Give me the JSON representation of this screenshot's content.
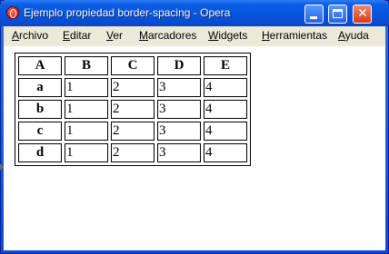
{
  "window": {
    "title": "Ejemplo propiedad border-spacing - Opera",
    "app_icon": "opera-icon",
    "controls": [
      "minimize",
      "maximize",
      "close"
    ]
  },
  "menubar": {
    "items": [
      {
        "label_first": "A",
        "label_rest": "rchivo"
      },
      {
        "label_first": "E",
        "label_rest": "ditar"
      },
      {
        "label_first": "V",
        "label_rest": "er"
      },
      {
        "label_first": "M",
        "label_rest": "arcadores"
      },
      {
        "label_first": "W",
        "label_rest": "idgets"
      },
      {
        "label_first": "H",
        "label_rest": "erramientas"
      },
      {
        "label_first": "A",
        "label_rest": "yuda"
      }
    ]
  },
  "table": {
    "headers": [
      "A",
      "B",
      "C",
      "D",
      "E"
    ],
    "rows": [
      {
        "label": "a",
        "cells": [
          "1",
          "2",
          "3",
          "4"
        ]
      },
      {
        "label": "b",
        "cells": [
          "1",
          "2",
          "3",
          "4"
        ]
      },
      {
        "label": "c",
        "cells": [
          "1",
          "2",
          "3",
          "4"
        ]
      },
      {
        "label": "d",
        "cells": [
          "1",
          "2",
          "3",
          "4"
        ]
      }
    ]
  }
}
